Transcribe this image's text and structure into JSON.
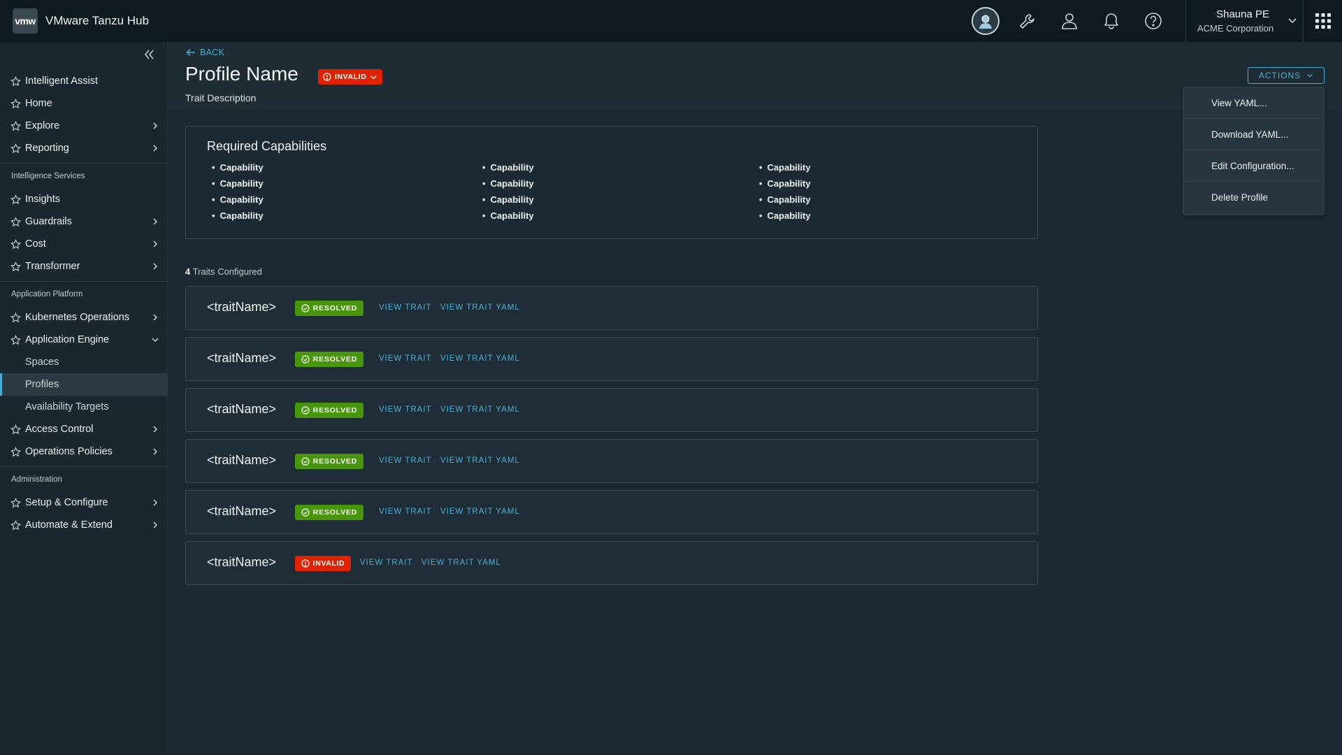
{
  "header": {
    "logo_text": "vmw",
    "app_title": "VMware Tanzu Hub",
    "user_name": "Shauna PE",
    "user_org": "ACME Corporation",
    "icons": [
      "avatar-icon",
      "wrench-icon",
      "user-icon",
      "bell-icon",
      "help-icon",
      "apps-grid-icon"
    ]
  },
  "sidebar": {
    "top_items": [
      {
        "label": "Intelligent Assist",
        "chevron": false
      },
      {
        "label": "Home",
        "chevron": false
      },
      {
        "label": "Explore",
        "chevron": true
      },
      {
        "label": "Reporting",
        "chevron": true
      }
    ],
    "intelligence_title": "Intelligence Services",
    "intelligence_items": [
      {
        "label": "Insights",
        "chevron": false
      },
      {
        "label": "Guardrails",
        "chevron": true
      },
      {
        "label": "Cost",
        "chevron": true
      },
      {
        "label": "Transformer",
        "chevron": true
      }
    ],
    "platform_title": "Application Platform",
    "platform_items": [
      {
        "label": "Kubernetes Operations",
        "chevron": true
      },
      {
        "label": "Application Engine",
        "chevron": "down"
      }
    ],
    "engine_sub_items": [
      {
        "label": "Spaces",
        "active": false
      },
      {
        "label": "Profiles",
        "active": true
      },
      {
        "label": "Availability Targets",
        "active": false
      }
    ],
    "platform_items_after": [
      {
        "label": "Access Control",
        "chevron": true
      },
      {
        "label": "Operations Policies",
        "chevron": true
      }
    ],
    "admin_title": "Administration",
    "admin_items": [
      {
        "label": "Setup & Configure",
        "chevron": true
      },
      {
        "label": "Automate & Extend",
        "chevron": true
      }
    ]
  },
  "page": {
    "back_label": "BACK",
    "title": "Profile Name",
    "status": "INVALID",
    "description": "Trait Description",
    "actions_label": "ACTIONS",
    "actions_menu": [
      "View YAML...",
      "Download YAML...",
      "Edit Configuration...",
      "Delete Profile"
    ]
  },
  "capabilities": {
    "title": "Required Capabilities",
    "columns": [
      [
        "Capability",
        "Capability",
        "Capability",
        "Capability"
      ],
      [
        "Capability",
        "Capability",
        "Capability",
        "Capability"
      ],
      [
        "Capability",
        "Capability",
        "Capability",
        "Capability"
      ]
    ]
  },
  "traits": {
    "count": "4",
    "count_label": "Traits Configured",
    "view_trait_label": "VIEW TRAIT",
    "view_yaml_label": "VIEW TRAIT YAML",
    "items": [
      {
        "name": "<traitName>",
        "status": "RESOLVED"
      },
      {
        "name": "<traitName>",
        "status": "RESOLVED"
      },
      {
        "name": "<traitName>",
        "status": "RESOLVED"
      },
      {
        "name": "<traitName>",
        "status": "RESOLVED"
      },
      {
        "name": "<traitName>",
        "status": "RESOLVED"
      },
      {
        "name": "<traitName>",
        "status": "INVALID"
      }
    ]
  },
  "colors": {
    "accent": "#49afd9",
    "resolved": "#48960c",
    "invalid": "#e02200",
    "background": "#1b2a32",
    "header": "#0f1a20"
  }
}
